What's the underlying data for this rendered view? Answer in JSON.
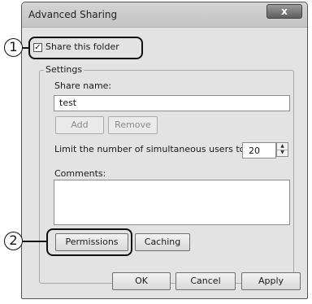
{
  "window": {
    "title": "Advanced Sharing",
    "close_label": "x"
  },
  "share": {
    "label": "Share this folder",
    "checked": true,
    "check_glyph": "✓"
  },
  "settings": {
    "legend": "Settings",
    "share_name_label": "Share name:",
    "share_name_value": "test",
    "add_label": "Add",
    "remove_label": "Remove",
    "limit_label": "Limit the number of simultaneous users to:",
    "limit_value": "20",
    "comments_label": "Comments:",
    "comments_value": "",
    "permissions_label": "Permissions",
    "caching_label": "Caching"
  },
  "footer": {
    "ok_label": "OK",
    "cancel_label": "Cancel",
    "apply_label": "Apply"
  },
  "callouts": {
    "marker_1": "1",
    "marker_2": "2"
  }
}
